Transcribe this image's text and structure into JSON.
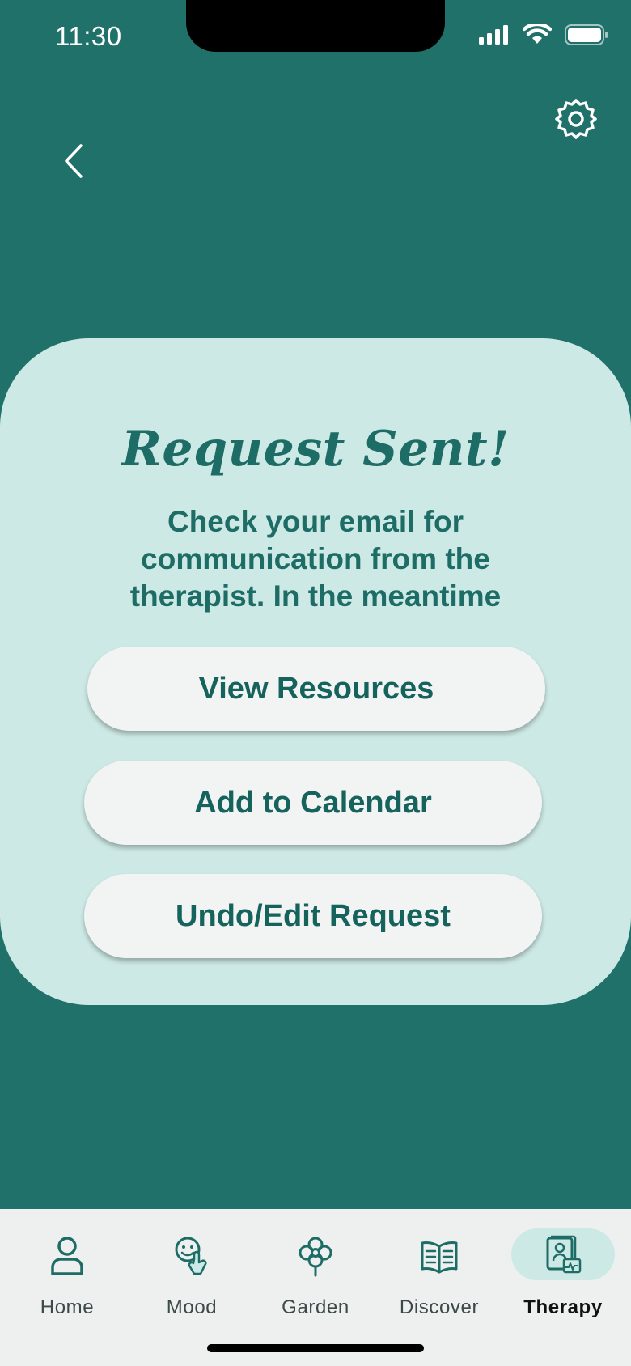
{
  "status_bar": {
    "time": "11:30",
    "icons": [
      "cellular-signal-icon",
      "wifi-icon",
      "battery-icon"
    ]
  },
  "header": {
    "back_icon": "chevron-left-icon",
    "settings_icon": "gear-icon"
  },
  "card": {
    "title": "Request Sent!",
    "message": "Check your email for communication from the therapist. In the meantime",
    "buttons": [
      {
        "label": "View Resources"
      },
      {
        "label": "Add to Calendar"
      },
      {
        "label": "Undo/Edit Request"
      }
    ]
  },
  "tab_bar": {
    "tabs": [
      {
        "label": "Home",
        "icon": "person-icon"
      },
      {
        "label": "Mood",
        "icon": "mood-face-icon"
      },
      {
        "label": "Garden",
        "icon": "flower-icon"
      },
      {
        "label": "Discover",
        "icon": "open-book-icon"
      },
      {
        "label": "Therapy",
        "icon": "therapy-icon"
      }
    ],
    "active": "Therapy"
  },
  "colors": {
    "background": "#20716A",
    "card": "#CDE9E5",
    "accent_text": "#1E6C66",
    "button": "#F2F4F4",
    "tab_bar": "#EEF0EF"
  }
}
